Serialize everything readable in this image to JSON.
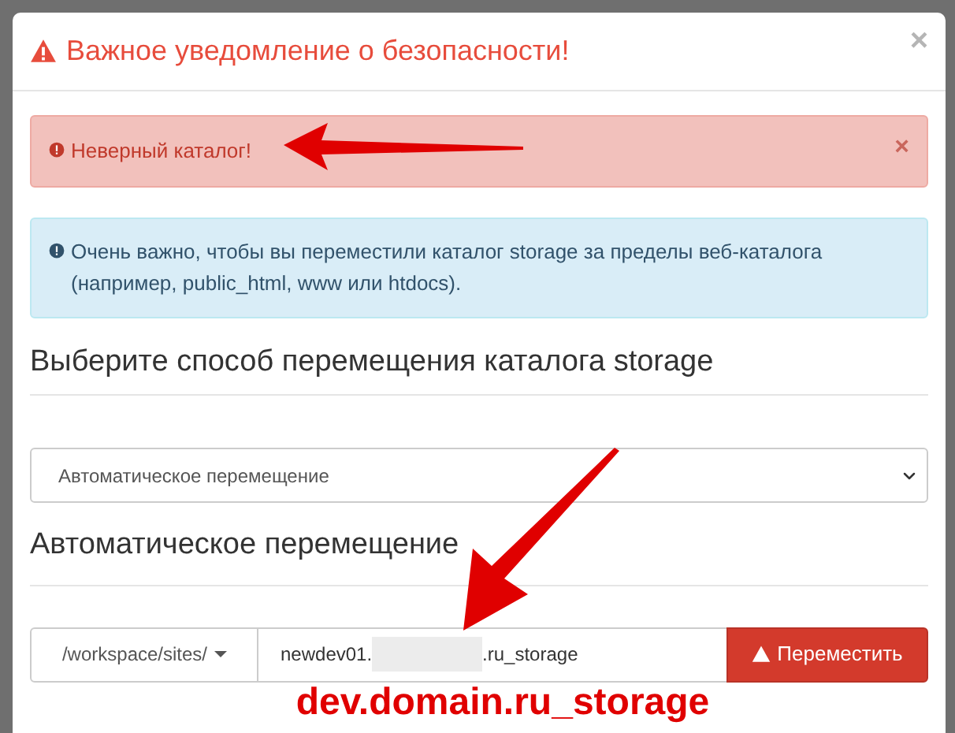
{
  "modal": {
    "title": "Важное уведомление о безопасности!",
    "close": "×"
  },
  "alerts": [
    {
      "kind": "danger",
      "text": "Неверный каталог!",
      "close": "×"
    },
    {
      "kind": "info",
      "text": "Очень важно, чтобы вы переместили каталог storage за пределы веб-каталога (например, public_html, www или htdocs)."
    }
  ],
  "method_heading": "Выберите способ перемещения каталога storage",
  "method_select": {
    "value": "Автоматическое перемещение"
  },
  "section_heading": "Автоматическое перемещение",
  "path_group": {
    "prefix": "/workspace/sites/",
    "value_start": "newdev01.",
    "value_end": ".ru_storage",
    "button": "Переместить"
  },
  "annotation": {
    "text": "dev.domain.ru_storage"
  }
}
